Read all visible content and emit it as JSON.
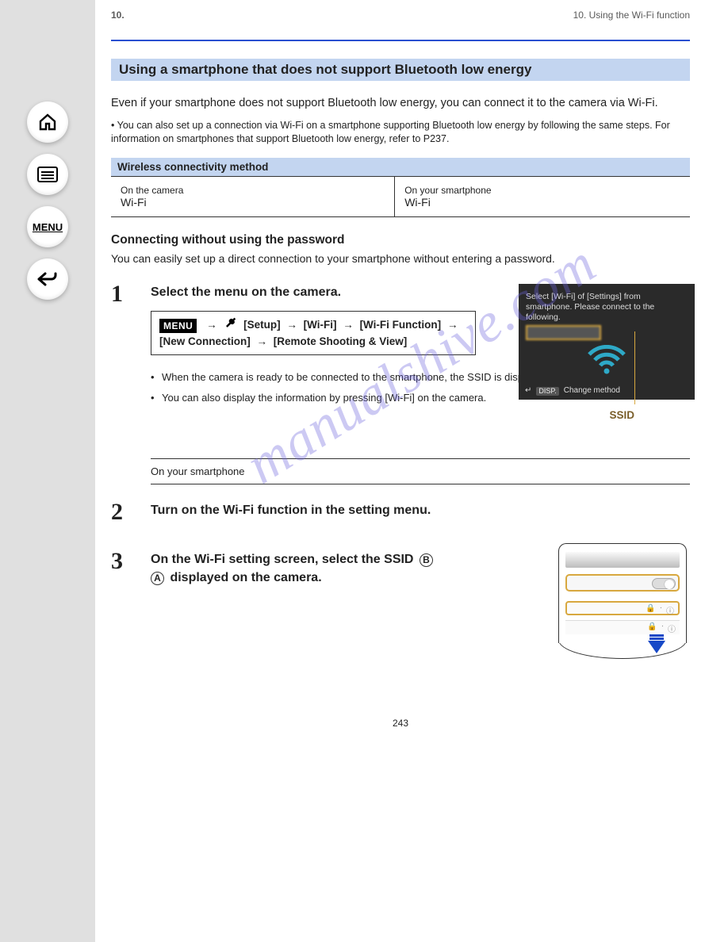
{
  "chapter": {
    "number": "10.",
    "title": "Using the Wi-Fi function",
    "running_head": "10. Using the Wi-Fi function"
  },
  "section": {
    "title": "Using a smartphone that does not support Bluetooth low energy"
  },
  "intro": {
    "body": "Even if your smartphone does not support Bluetooth low energy, you can connect it to the camera via Wi-Fi.",
    "note1": "• You can also set up a connection via Wi-Fi on a smartphone supporting Bluetooth low energy by following the same steps. For information on smartphones that support Bluetooth low energy, refer to",
    "note1_link": "P237",
    "note1_tail": "."
  },
  "wireless_box": {
    "title": "Wireless connectivity method",
    "cell1_a": "On the camera",
    "cell1_b": "Wi-Fi",
    "cell2_a": "On your smartphone",
    "cell2_b": "Wi-Fi"
  },
  "default_password_heading": "Connecting without using the password",
  "default_password_body": "You can easily set up a direct connection to your smartphone without entering a password.",
  "steps": {
    "s1_title": "Select the menu on the camera.",
    "menu_path": {
      "badge": "MENU",
      "group": "[Setup]",
      "a": "[Wi-Fi]",
      "b": "[Wi-Fi Function]",
      "c": "[New Connection]",
      "d": "[Remote Shooting & View]"
    },
    "camera_screen": {
      "line1": "Select [Wi-Fi] of [Settings] from smartphone. Please connect to the following.",
      "bottom_label": "DISP.",
      "bottom_text": "Change method"
    },
    "ssid_label": "SSID",
    "step1_bullets": [
      "When the camera is ready to be connected to the smartphone, the SSID is displayed.",
      "You can also display the information by pressing [Wi-Fi] on the camera."
    ],
    "s2_on_smartphone": "On your smartphone",
    "s2_title": "Turn on the Wi-Fi function in the setting menu.",
    "s3_title_a": "On the Wi-Fi setting screen, select the SSID",
    "s3_title_b": "displayed on the camera."
  },
  "footer": {
    "page_number": "243"
  },
  "watermark": "manualshive.com",
  "nav": {
    "home": "Home",
    "toc": "Contents",
    "menu": "MENU",
    "back": "Back"
  }
}
